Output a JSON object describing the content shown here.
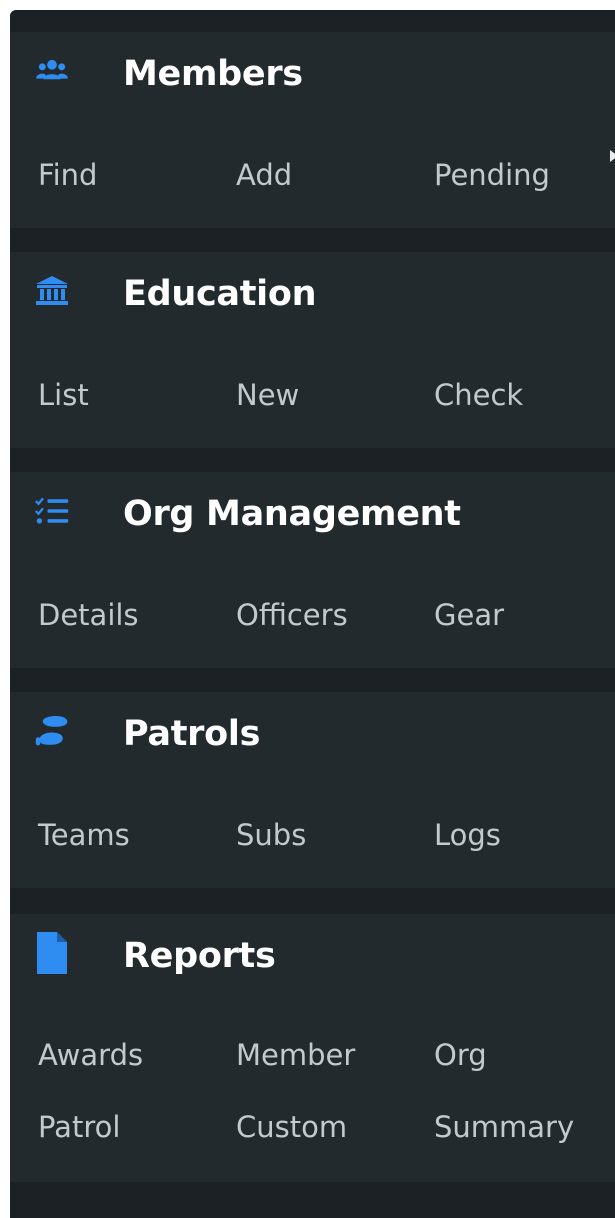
{
  "sections": [
    {
      "title": "Members",
      "icon": "users-icon",
      "links": [
        "Find",
        "Add",
        "Pending"
      ]
    },
    {
      "title": "Education",
      "icon": "institution-icon",
      "links": [
        "List",
        "New",
        "Check"
      ]
    },
    {
      "title": "Org Management",
      "icon": "tasks-list-icon",
      "links": [
        "Details",
        "Officers",
        "Gear"
      ]
    },
    {
      "title": "Patrols",
      "icon": "footprints-icon",
      "links": [
        "Teams",
        "Subs",
        "Logs"
      ]
    },
    {
      "title": "Reports",
      "icon": "file-icon",
      "links": [
        "Awards",
        "Member",
        "Org",
        "Patrol",
        "Custom",
        "Summary"
      ]
    }
  ],
  "colors": {
    "accent": "#2f8cf0",
    "card_bg": "#232a2e",
    "panel_bg": "#1b2124",
    "title_text": "#ffffff",
    "link_text": "#c3c9cd"
  }
}
